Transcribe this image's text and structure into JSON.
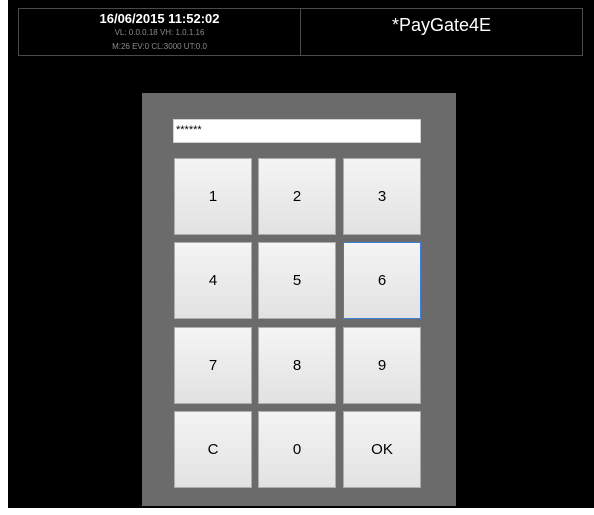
{
  "status": {
    "datetime": "16/06/2015 11:52:02",
    "line1": "VL: 0.0.0.18 VH: 1.0.1.16",
    "line2": "M:26 EV:0 CL:3000 UT:0.0"
  },
  "app": {
    "title": "*PayGate4E"
  },
  "pin": {
    "value": "******"
  },
  "keypad": {
    "keys": [
      "1",
      "2",
      "3",
      "4",
      "5",
      "6",
      "7",
      "8",
      "9",
      "C",
      "0",
      "OK"
    ],
    "focused_key": "6"
  },
  "colors": {
    "background": "#000000",
    "panel": "#6b6b6b",
    "key_face": "#eaeaea",
    "focus_border": "#3c7fd6"
  }
}
